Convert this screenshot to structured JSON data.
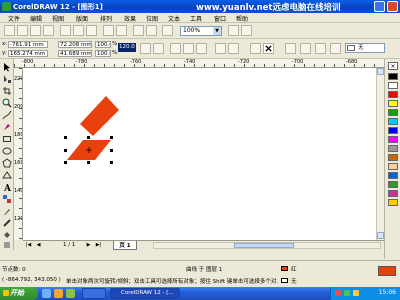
{
  "window": {
    "title": "CorelDRAW 12 - [图形1]",
    "watermark": "www.yuanlv.net远虑电脑在线培训"
  },
  "menu": [
    "文件",
    "编辑",
    "视图",
    "版面",
    "排列",
    "效果",
    "位图",
    "文本",
    "工具",
    "窗口",
    "帮助"
  ],
  "toolbar": {
    "zoom_value": "100%"
  },
  "property_bar": {
    "x": "-761.91 mm",
    "y": "165.274 mm",
    "width": "72.208 mm",
    "height": "41.689 mm",
    "scale_x": "100.0",
    "scale_y": "100.0",
    "percent_sign": "%",
    "angle": "120.0",
    "outline_width": "无"
  },
  "icons": {
    "tools": [
      "pick-tool-icon",
      "shape-tool-icon",
      "crop-tool-icon",
      "zoom-tool-icon",
      "freehand-tool-icon",
      "smart-fill-icon",
      "rectangle-tool-icon",
      "ellipse-tool-icon",
      "polygon-tool-icon",
      "basic-shapes-icon",
      "text-tool-icon",
      "interactive-blend-icon",
      "eyedropper-icon",
      "outline-tool-icon",
      "fill-tool-icon",
      "interactive-fill-icon"
    ]
  },
  "rulers": {
    "h_numbers": [
      "-800",
      "-780",
      "-760",
      "-740",
      "-720",
      "-700",
      "-680"
    ],
    "v_numbers": [
      "220",
      "200",
      "180",
      "160",
      "140",
      "120"
    ]
  },
  "shapes": {
    "fill_color": "#e8410e"
  },
  "document": {
    "page_count": "1 / 1",
    "page_tab": "页 1"
  },
  "status": {
    "node_info": "节点数: 0",
    "object_info": "曲线 于 图层 1",
    "hint": "单击对象两次可旋转/倾斜；双击工具可选择所有对象；按住 Shift 键单击可选择多个对...",
    "coords": "( -864.792, 343.050 )",
    "fill_label": "红",
    "outline_label": "无"
  },
  "taskbar": {
    "start_label": "开始",
    "tasks": [
      "",
      "CorelDRAW 12 - [..."
    ],
    "clock": "15:06"
  }
}
